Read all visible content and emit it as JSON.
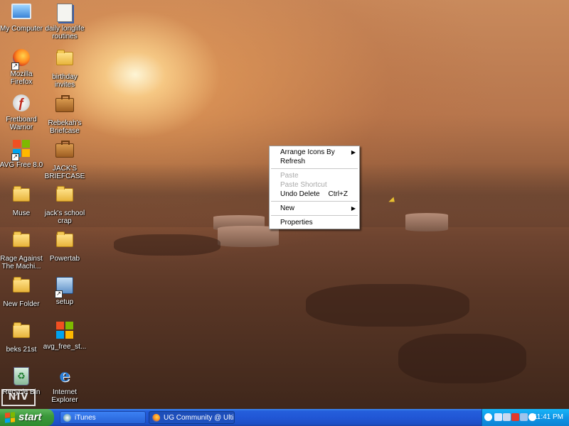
{
  "desktop": {
    "icons": [
      {
        "label": "My Computer",
        "icon": "my-computer-icon"
      },
      {
        "label": "daily longlife routines",
        "icon": "document-icon"
      },
      {
        "label": "Mozilla Firefox",
        "icon": "firefox-icon"
      },
      {
        "label": "birthday invites",
        "icon": "folder-icon"
      },
      {
        "label": "Fretboard Warrior",
        "icon": "flash-icon"
      },
      {
        "label": "Rebekah's Briefcase",
        "icon": "briefcase-icon"
      },
      {
        "label": "AVG Free 8.0",
        "icon": "avg-icon"
      },
      {
        "label": "JACK'S BRIEFCASE",
        "icon": "briefcase-icon"
      },
      {
        "label": "Muse",
        "icon": "folder-icon"
      },
      {
        "label": "jack's school crap",
        "icon": "folder-icon"
      },
      {
        "label": "Rage Against The Machi...",
        "icon": "folder-icon"
      },
      {
        "label": "Powertab",
        "icon": "folder-icon"
      },
      {
        "label": "New Folder",
        "icon": "folder-icon"
      },
      {
        "label": "setup",
        "icon": "setup-icon"
      },
      {
        "label": "beks 21st",
        "icon": "folder-icon"
      },
      {
        "label": "avg_free_st...",
        "icon": "avg-icon"
      },
      {
        "label": "Recycle Bin",
        "icon": "recycle-bin-icon"
      },
      {
        "label": "Internet Explorer",
        "icon": "internet-explorer-icon"
      }
    ]
  },
  "context_menu": {
    "items": [
      {
        "label": "Arrange Icons By",
        "submenu": true,
        "enabled": true
      },
      {
        "label": "Refresh",
        "enabled": true
      },
      {
        "label": "Paste",
        "enabled": false
      },
      {
        "label": "Paste Shortcut",
        "enabled": false
      },
      {
        "label": "Undo Delete",
        "shortcut": "Ctrl+Z",
        "enabled": true
      },
      {
        "label": "New",
        "submenu": true,
        "enabled": true
      },
      {
        "label": "Properties",
        "enabled": true
      }
    ]
  },
  "watermark": "NIV",
  "taskbar": {
    "start_label": "start",
    "tasks": [
      {
        "label": "iTunes",
        "icon": "itunes-icon",
        "active": false
      },
      {
        "label": "UG Community @ Ulti...",
        "icon": "firefox-icon",
        "active": true
      },
      {
        "label": "",
        "icon": "",
        "active": false
      }
    ],
    "tray_icons": [
      "network-icon",
      "speaker-icon",
      "security-icon",
      "monitor-icon",
      "avg-tray-icon",
      "itunes-tray-icon"
    ],
    "clock": "11:41 PM"
  },
  "colors": {
    "taskbar": "#245edb",
    "start_button": "#3c9a3c",
    "tray": "#0f95e6",
    "disabled_menu_text": "#a8a8a8"
  }
}
